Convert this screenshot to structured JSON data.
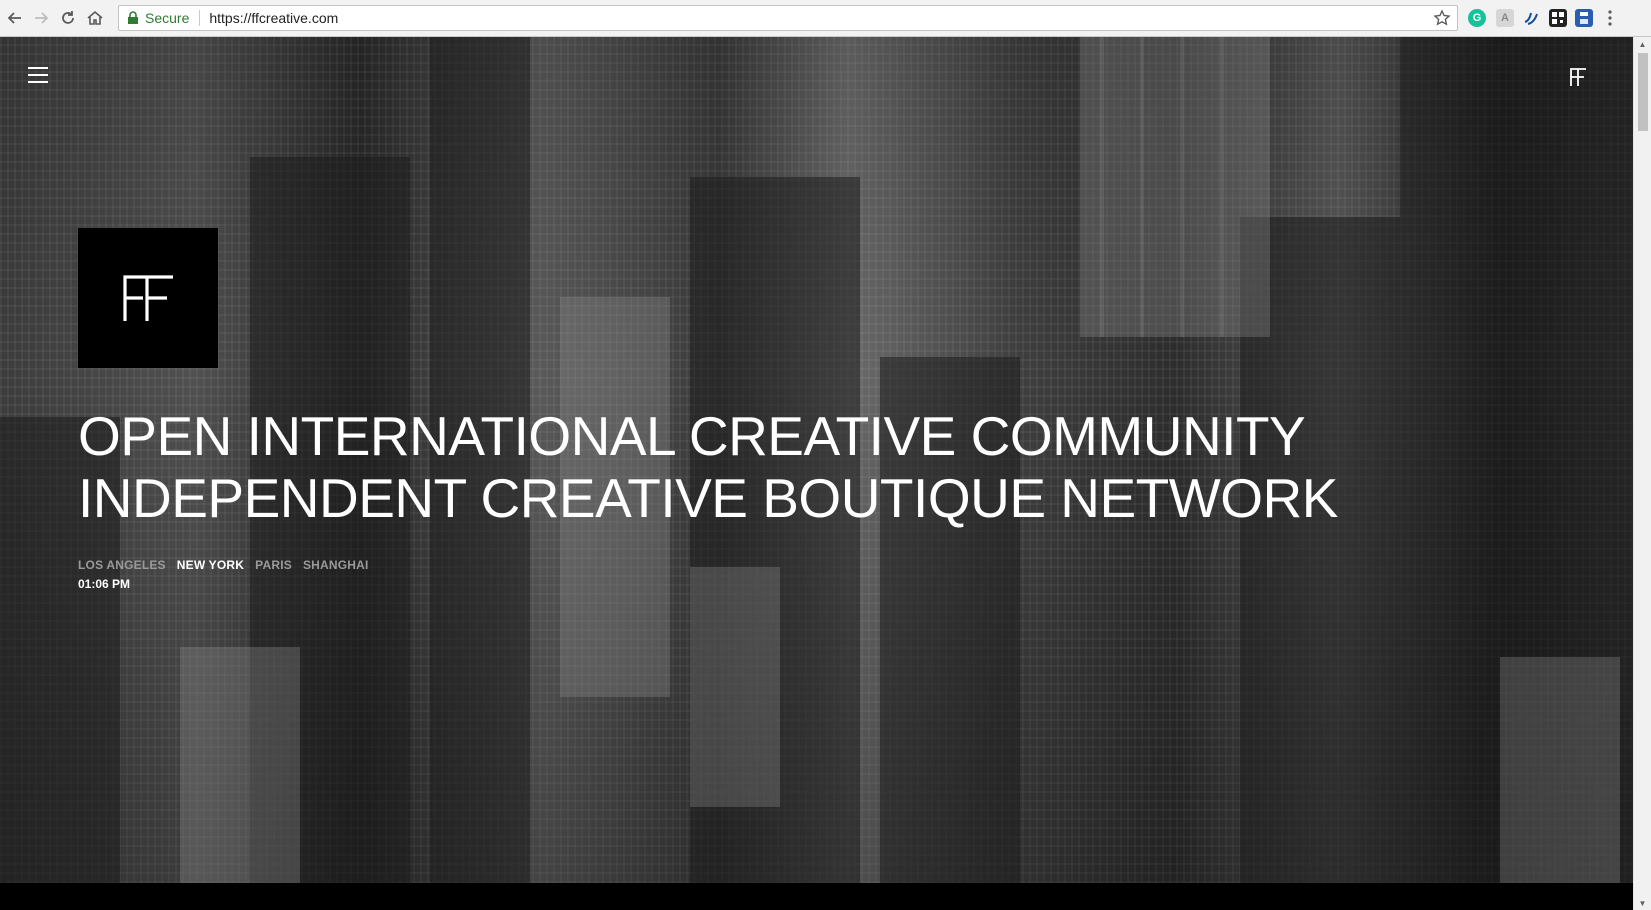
{
  "browser": {
    "secure_label": "Secure",
    "url": "https://ffcreative.com",
    "icons": [
      "back-arrow-icon",
      "forward-arrow-icon",
      "reload-icon",
      "home-icon",
      "lock-icon",
      "star-icon",
      "grammarly-icon",
      "extension-a-icon",
      "extension-wave-icon",
      "extension-qr-icon",
      "save-icon",
      "menu-dots-icon"
    ]
  },
  "page": {
    "headline_lines": [
      "OPEN INTERNATIONAL CREATIVE COMMUNITY",
      "INDEPENDENT CREATIVE BOUTIQUE NETWORK"
    ],
    "cities": [
      {
        "label": "LOS ANGELES",
        "active": false
      },
      {
        "label": "NEW YORK",
        "active": true
      },
      {
        "label": "PARIS",
        "active": false
      },
      {
        "label": "SHANGHAI",
        "active": false
      }
    ],
    "time": "01:06 PM",
    "colors": {
      "text": "#ffffff",
      "inactive_city": "#9a9a9a",
      "logo_bg": "#000000",
      "secure_green": "#2e7d32"
    }
  }
}
